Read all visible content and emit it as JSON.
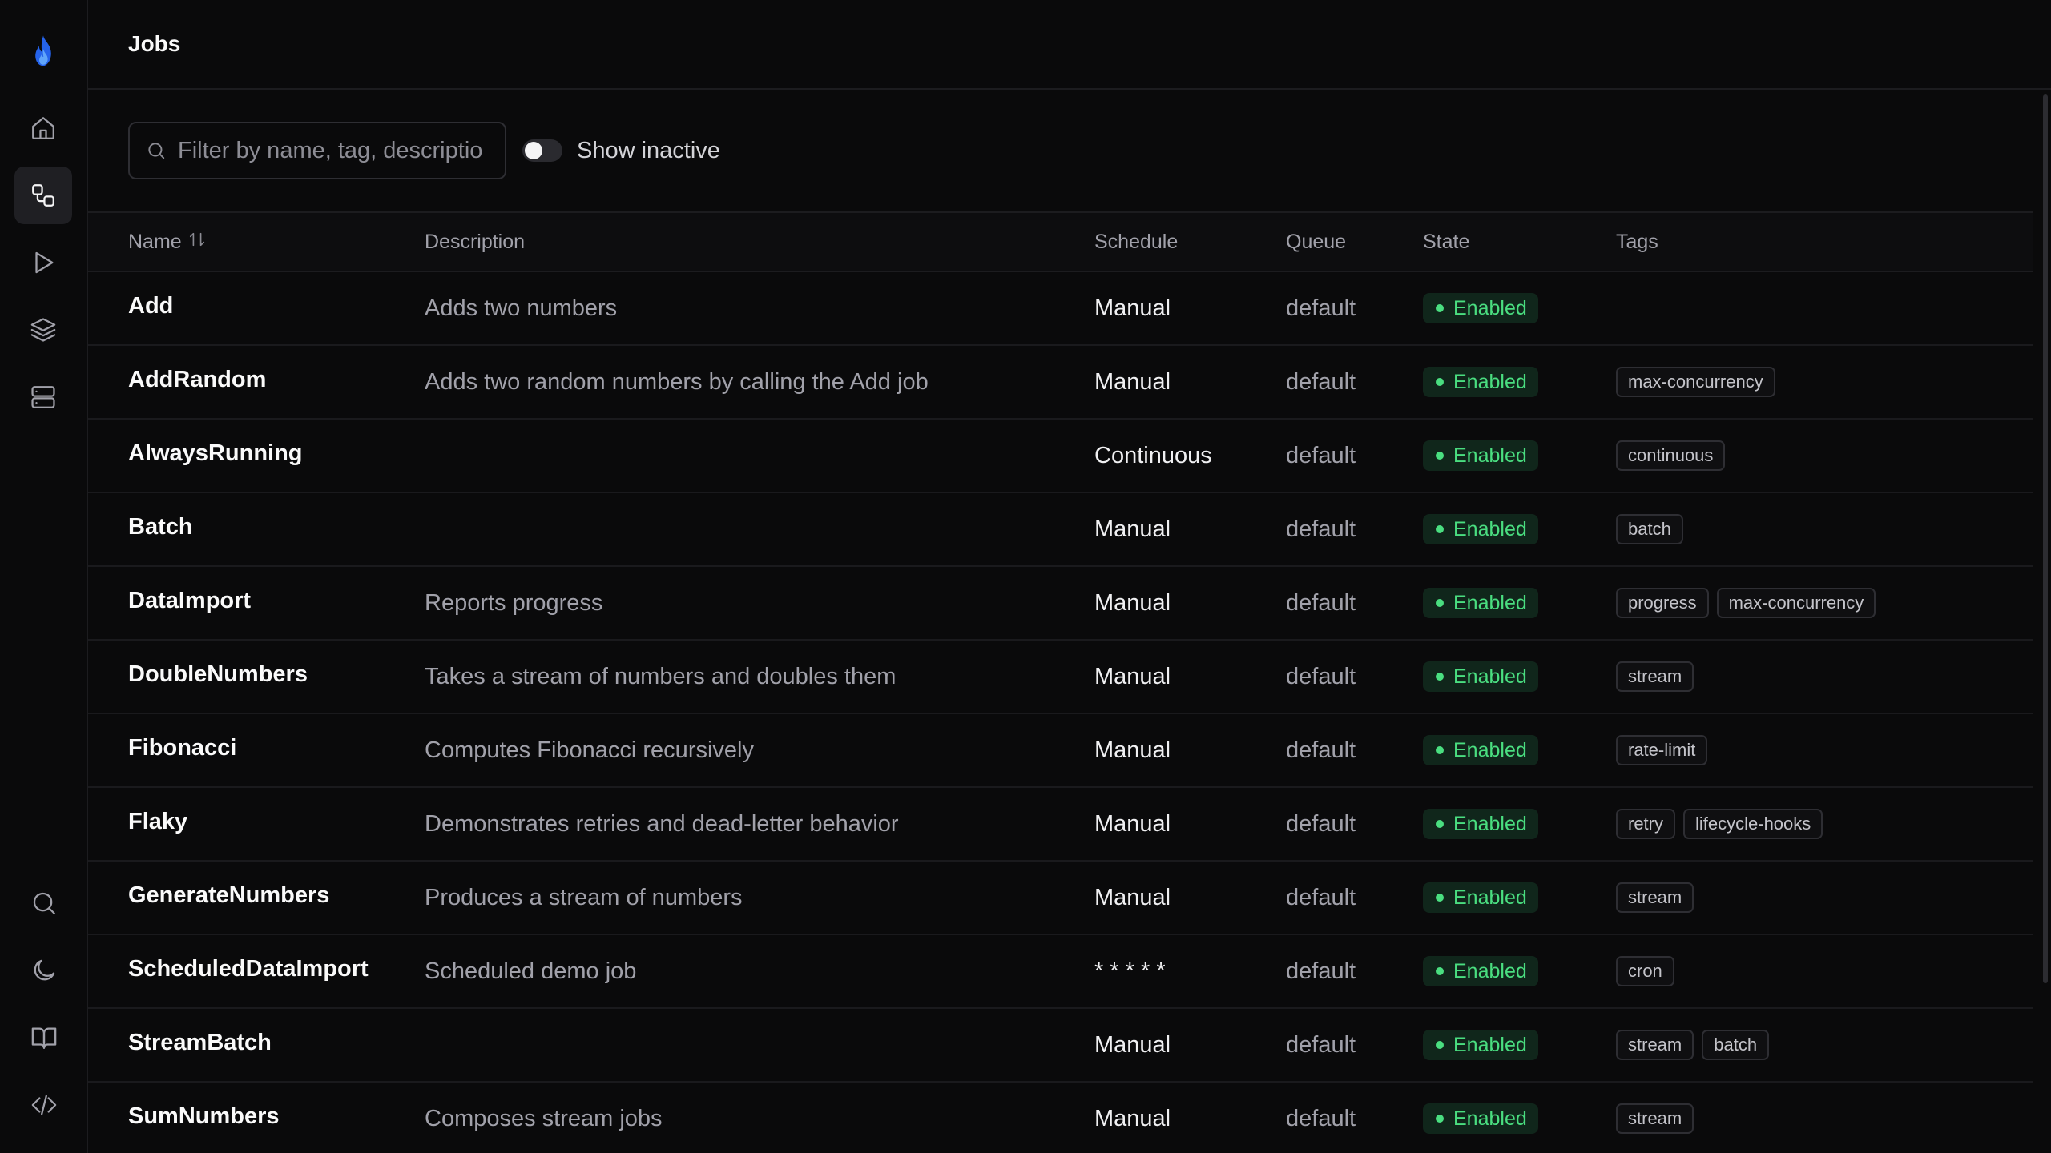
{
  "header": {
    "title": "Jobs"
  },
  "filters": {
    "search_placeholder": "Filter by name, tag, description...",
    "search_value": "",
    "show_inactive_label": "Show inactive",
    "show_inactive": false
  },
  "table": {
    "columns": {
      "name": "Name",
      "description": "Description",
      "schedule": "Schedule",
      "queue": "Queue",
      "state": "State",
      "tags": "Tags"
    },
    "rows": [
      {
        "name": "Add",
        "description": "Adds two numbers",
        "schedule": "Manual",
        "queue": "default",
        "state": "Enabled",
        "tags": []
      },
      {
        "name": "AddRandom",
        "description": "Adds two random numbers by calling the Add job",
        "schedule": "Manual",
        "queue": "default",
        "state": "Enabled",
        "tags": [
          "max-concurrency"
        ]
      },
      {
        "name": "AlwaysRunning",
        "description": "",
        "schedule": "Continuous",
        "queue": "default",
        "state": "Enabled",
        "tags": [
          "continuous"
        ]
      },
      {
        "name": "Batch",
        "description": "",
        "schedule": "Manual",
        "queue": "default",
        "state": "Enabled",
        "tags": [
          "batch"
        ]
      },
      {
        "name": "DataImport",
        "description": "Reports progress",
        "schedule": "Manual",
        "queue": "default",
        "state": "Enabled",
        "tags": [
          "progress",
          "max-concurrency"
        ]
      },
      {
        "name": "DoubleNumbers",
        "description": "Takes a stream of numbers and doubles them",
        "schedule": "Manual",
        "queue": "default",
        "state": "Enabled",
        "tags": [
          "stream"
        ]
      },
      {
        "name": "Fibonacci",
        "description": "Computes Fibonacci recursively",
        "schedule": "Manual",
        "queue": "default",
        "state": "Enabled",
        "tags": [
          "rate-limit"
        ]
      },
      {
        "name": "Flaky",
        "description": "Demonstrates retries and dead-letter behavior",
        "schedule": "Manual",
        "queue": "default",
        "state": "Enabled",
        "tags": [
          "retry",
          "lifecycle-hooks"
        ]
      },
      {
        "name": "GenerateNumbers",
        "description": "Produces a stream of numbers",
        "schedule": "Manual",
        "queue": "default",
        "state": "Enabled",
        "tags": [
          "stream"
        ]
      },
      {
        "name": "ScheduledDataImport",
        "description": "Scheduled demo job",
        "schedule": "* * * * *",
        "queue": "default",
        "state": "Enabled",
        "tags": [
          "cron"
        ]
      },
      {
        "name": "StreamBatch",
        "description": "",
        "schedule": "Manual",
        "queue": "default",
        "state": "Enabled",
        "tags": [
          "stream",
          "batch"
        ]
      },
      {
        "name": "SumNumbers",
        "description": "Composes stream jobs",
        "schedule": "Manual",
        "queue": "default",
        "state": "Enabled",
        "tags": [
          "stream"
        ]
      }
    ]
  },
  "sidebar": {
    "logo_icon": "flame-icon",
    "top_items": [
      {
        "icon": "home-icon",
        "active": false
      },
      {
        "icon": "workflow-icon",
        "active": true
      },
      {
        "icon": "play-icon",
        "active": false
      },
      {
        "icon": "layers-icon",
        "active": false
      },
      {
        "icon": "server-icon",
        "active": false
      }
    ],
    "bottom_items": [
      {
        "icon": "search-icon"
      },
      {
        "icon": "moon-icon"
      },
      {
        "icon": "book-icon"
      },
      {
        "icon": "code-icon"
      }
    ]
  },
  "colors": {
    "background": "#0a0a0b",
    "accent": "#3b82f6",
    "enabled": "#4ade80",
    "enabled_bg": "#10261b"
  }
}
